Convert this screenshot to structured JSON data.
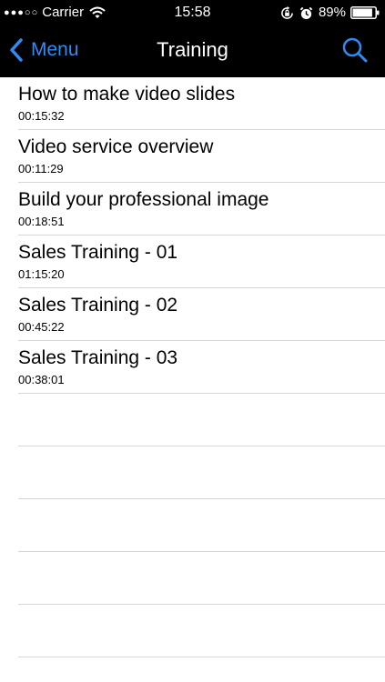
{
  "status_bar": {
    "signal": "●●●○○",
    "carrier": "Carrier",
    "time": "15:58",
    "battery_percent": "89%",
    "icons": [
      "wifi-icon",
      "rotation-lock-icon",
      "alarm-icon",
      "battery-icon"
    ],
    "battery_level": 0.89
  },
  "nav": {
    "back_label": "Menu",
    "title": "Training",
    "search_icon": "search-icon"
  },
  "colors": {
    "accent": "#2f8cf5",
    "bar_background": "#000000",
    "separator": "#d6d6d6"
  },
  "items": [
    {
      "title": "How to make video slides",
      "duration": "00:15:32"
    },
    {
      "title": "Video service overview",
      "duration": "00:11:29"
    },
    {
      "title": "Build your professional image",
      "duration": "00:18:51"
    },
    {
      "title": "Sales Training - 01",
      "duration": "01:15:20"
    },
    {
      "title": "Sales Training - 02",
      "duration": "00:45:22"
    },
    {
      "title": "Sales Training - 03",
      "duration": "00:38:01"
    }
  ]
}
